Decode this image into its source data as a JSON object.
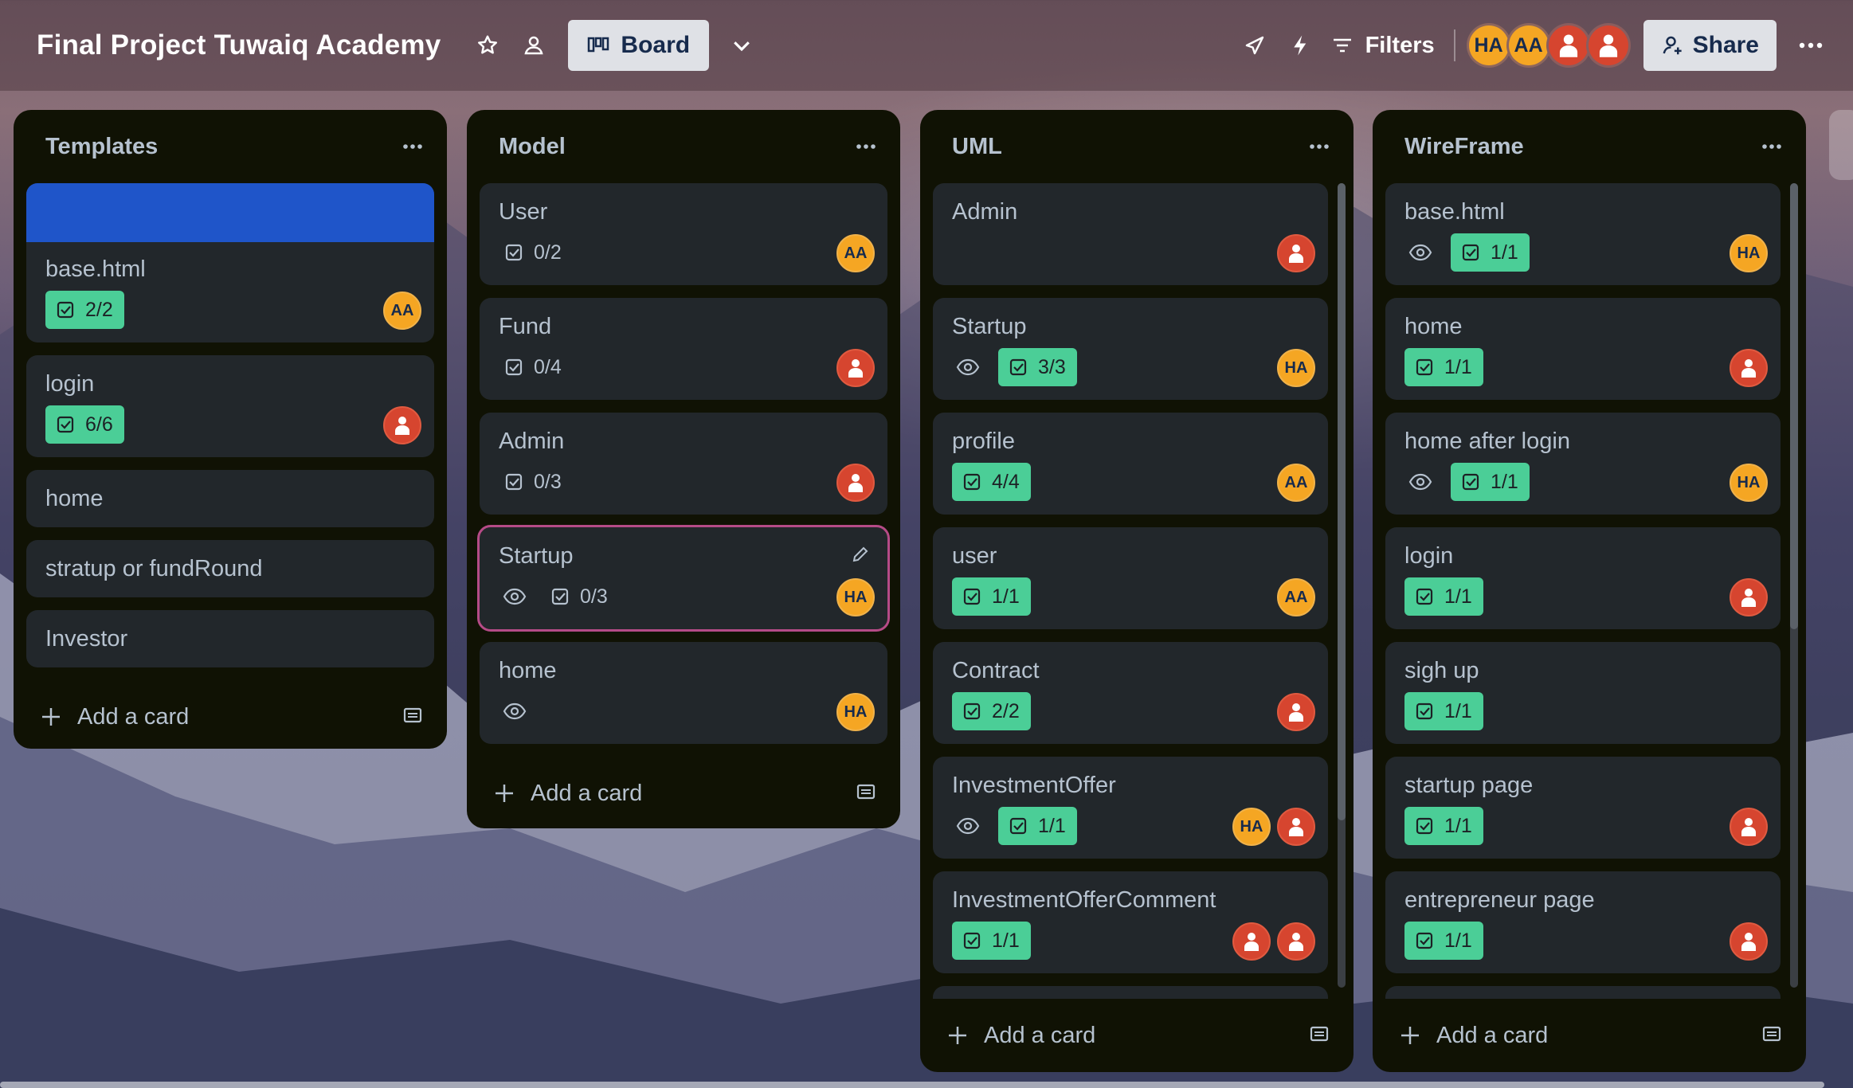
{
  "header": {
    "board_title": "Final Project Tuwaiq Academy",
    "view_label": "Board",
    "filters_label": "Filters",
    "share_label": "Share",
    "members": [
      {
        "initials": "HA",
        "color": "#f5a623"
      },
      {
        "initials": "AA",
        "color": "#f5a623"
      },
      {
        "initials": "",
        "color": "#d6452f"
      },
      {
        "initials": "",
        "color": "#d6452f"
      }
    ]
  },
  "lists": {
    "templates": {
      "title": "Templates",
      "add_label": "Add a card",
      "cards": [
        {
          "title": "base.html",
          "checklist": "2/2",
          "member": "AA"
        },
        {
          "title": "login",
          "checklist": "6/6"
        },
        {
          "title": "home"
        },
        {
          "title": "stratup or fundRound"
        },
        {
          "title": "Investor"
        }
      ]
    },
    "model": {
      "title": "Model",
      "add_label": "Add a card",
      "cards": [
        {
          "title": "User",
          "checklist": "0/2",
          "member": "AA"
        },
        {
          "title": "Fund",
          "checklist": "0/4"
        },
        {
          "title": "Admin",
          "checklist": "0/3"
        },
        {
          "title": "Startup",
          "checklist": "0/3",
          "member": "HA"
        },
        {
          "title": "home",
          "member": "HA"
        }
      ]
    },
    "uml": {
      "title": "UML",
      "add_label": "Add a card",
      "cards": [
        {
          "title": "Admin"
        },
        {
          "title": "Startup",
          "checklist": "3/3",
          "member": "HA"
        },
        {
          "title": "profile",
          "checklist": "4/4",
          "member": "AA"
        },
        {
          "title": "user",
          "checklist": "1/1",
          "member": "AA"
        },
        {
          "title": "Contract",
          "checklist": "2/2"
        },
        {
          "title": "InvestmentOffer",
          "checklist": "1/1",
          "member": "HA"
        },
        {
          "title": "InvestmentOfferComment",
          "checklist": "1/1"
        }
      ]
    },
    "wireframe": {
      "title": "WireFrame",
      "add_label": "Add a card",
      "cards": [
        {
          "title": "base.html",
          "checklist": "1/1",
          "member": "HA"
        },
        {
          "title": "home",
          "checklist": "1/1"
        },
        {
          "title": "home after login",
          "checklist": "1/1",
          "member": "HA"
        },
        {
          "title": "login",
          "checklist": "1/1"
        },
        {
          "title": "sigh up",
          "checklist": "1/1"
        },
        {
          "title": "startup page",
          "checklist": "1/1"
        },
        {
          "title": "entrepreneur page",
          "checklist": "1/1"
        }
      ]
    }
  },
  "colors": {
    "list_bg": "#101204",
    "card_bg": "#22272b",
    "checklist_done": "#4bce97",
    "cover_blue": "#1f55c9",
    "avatar_orange": "#f5a623",
    "avatar_red": "#d6452f"
  }
}
